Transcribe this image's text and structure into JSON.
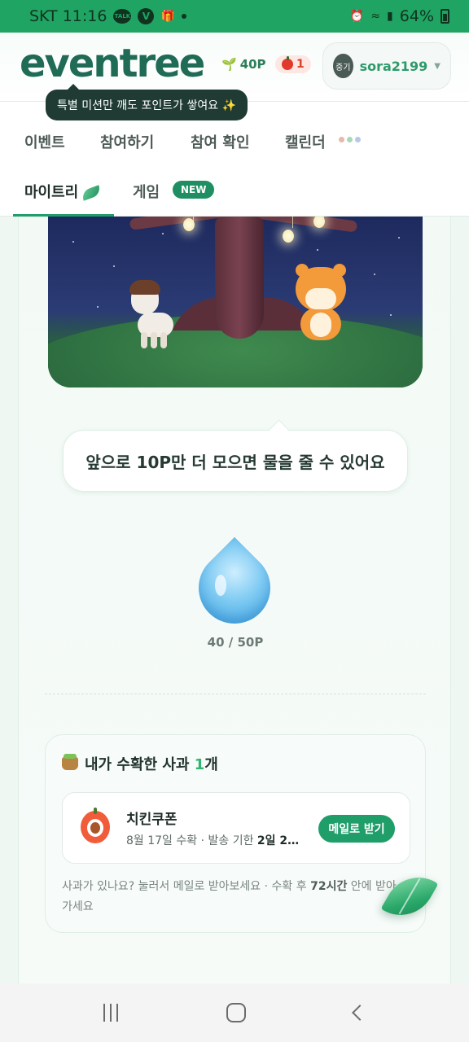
{
  "status_bar": {
    "carrier_time": "SKT 11:16",
    "talk_icon_label": "TALK",
    "v_icon_label": "V",
    "battery": "64%"
  },
  "header": {
    "logo": "eventree",
    "points": "40P",
    "apples": "1",
    "avatar_label": "중기",
    "username": "sora2199",
    "tooltip": "특별 미션만 깨도 포인트가 쌓여요 ✨"
  },
  "tabs": {
    "row1": [
      "이벤트",
      "참여하기",
      "참여 확인",
      "캘린더"
    ],
    "row2": [
      "마이트리",
      "게임"
    ],
    "new_badge": "NEW",
    "dot_colors": [
      "#e8b8a8",
      "#a8d8b8",
      "#b8c8e8"
    ]
  },
  "main": {
    "speech": "앞으로 10P만 더 모으면 물을 줄 수 있어요",
    "progress": {
      "current": 40,
      "goal": 50,
      "text": "40 / 50P"
    }
  },
  "apple_section": {
    "title_prefix": "내가 수확한 사과 ",
    "count": "1",
    "title_suffix": "개",
    "item": {
      "name": "치킨쿠폰",
      "sub_prefix": "8월 17일 수확 · 발송 기한 ",
      "sub_bold": "2일 2…",
      "button": "메일로 받기"
    },
    "note_prefix": "사과가 있나요? 눌러서 메일로 받아보세요 · 수확 후 ",
    "note_bold": "72시간",
    "note_suffix": " 안에 받아가세요"
  },
  "colors": {
    "brand_green": "#1f9e6a",
    "status_bar": "#1fa463"
  }
}
